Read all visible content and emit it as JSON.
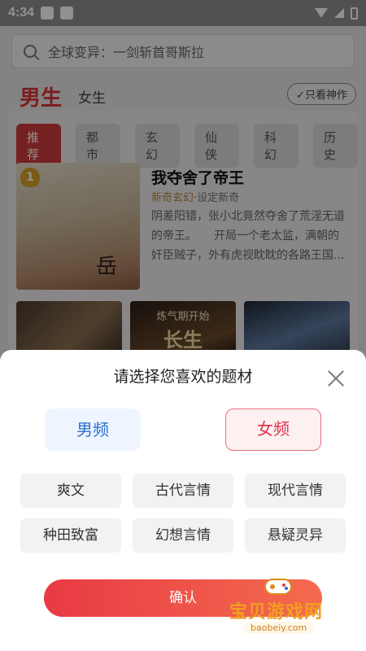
{
  "status_bar": {
    "time": "4:34"
  },
  "search": {
    "placeholder": "全球变异：一剑斩首哥斯拉"
  },
  "gender_tabs": {
    "male": "男生",
    "female": "女生",
    "only_god_label": "只看神作"
  },
  "category_chips": [
    "推荐",
    "都市",
    "玄幻",
    "仙侠",
    "科幻",
    "历史"
  ],
  "featured_book": {
    "rank": "1",
    "cover_title": "岳",
    "title": "我夺舍了帝王",
    "tag_main": "新奇玄幻",
    "tag_sub": "·设定新奇",
    "description": "阴差阳错，张小北竟然夺舍了荒淫无道的帝王。　　开局一个老太监，满朝的奸臣贼子，外有虎视眈眈的各路王国..."
  },
  "thumbnails": [
    {
      "top": "",
      "big": ""
    },
    {
      "top": "炼气期开始",
      "big": "长生"
    },
    {
      "top": "",
      "big": ""
    }
  ],
  "sheet": {
    "title": "请选择您喜欢的题材",
    "male_freq": "男频",
    "female_freq": "女频",
    "genres": [
      "爽文",
      "古代言情",
      "现代言情",
      "种田致富",
      "幻想言情",
      "悬疑灵异"
    ],
    "confirm": "确认"
  },
  "watermark": {
    "text": "宝贝游戏网",
    "url": "baobeiy.com"
  }
}
